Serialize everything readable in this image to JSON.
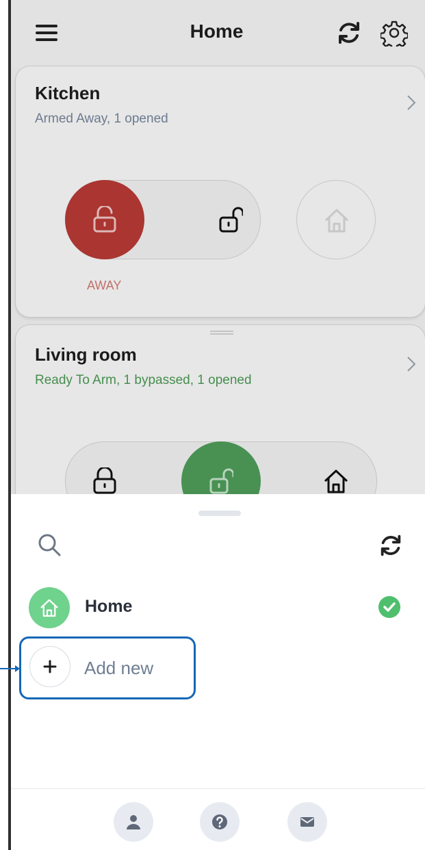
{
  "header": {
    "title": "Home",
    "icons": [
      "menu-icon",
      "refresh-icon",
      "gear-icon"
    ]
  },
  "partitions": [
    {
      "name": "Kitchen",
      "status": "Armed Away, 1 opened",
      "active_mode": "AWAY",
      "active_color": "#b93a36"
    },
    {
      "name": "Living room",
      "status": "Ready To Arm, 1 bypassed, 1 opened",
      "active_color": "#4f9e5b"
    }
  ],
  "sheet": {
    "location": {
      "name": "Home",
      "selected": true
    },
    "add_label": "Add new",
    "footer_icons": [
      "user-icon",
      "help-icon",
      "mail-icon"
    ],
    "accent": "#1467b6"
  }
}
